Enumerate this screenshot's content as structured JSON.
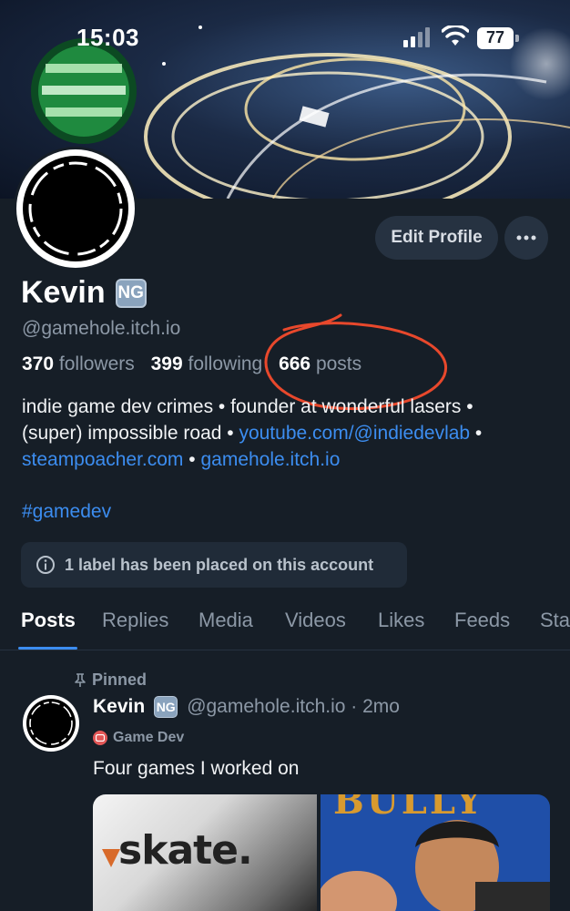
{
  "status_bar": {
    "time": "15:03",
    "battery": "77"
  },
  "profile": {
    "edit_button": "Edit Profile",
    "display_name": "Kevin",
    "badge": "NG",
    "handle": "@gamehole.itch.io",
    "followers_count": "370",
    "followers_label": "followers",
    "following_count": "399",
    "following_label": "following",
    "posts_count": "666",
    "posts_label": "posts",
    "bio": {
      "line1": "indie game dev crimes • founder at wonderful lasers •",
      "line2_text": "(super) impossible road • ",
      "link1": "youtube.com/@indiedevlab",
      "sep1": " •",
      "link2": "steampoacher.com",
      "sep2": " • ",
      "link3": "gamehole.itch.io"
    },
    "hashtag": "#gamedev",
    "label_notice": "1 label has been placed on this account"
  },
  "tabs": [
    "Posts",
    "Replies",
    "Media",
    "Videos",
    "Likes",
    "Feeds",
    "Sta"
  ],
  "post": {
    "pinned_label": "Pinned",
    "author_name": "Kevin",
    "author_badge": "NG",
    "author_handle": "@gamehole.itch.io · 2mo",
    "feed_name": "Game Dev",
    "text": "Four games I worked on",
    "image_left_title": "skate.",
    "image_right_title": "BULLY"
  },
  "colors": {
    "accent": "#3c8df0",
    "background": "#161e27",
    "annotation": "#e8482c"
  }
}
